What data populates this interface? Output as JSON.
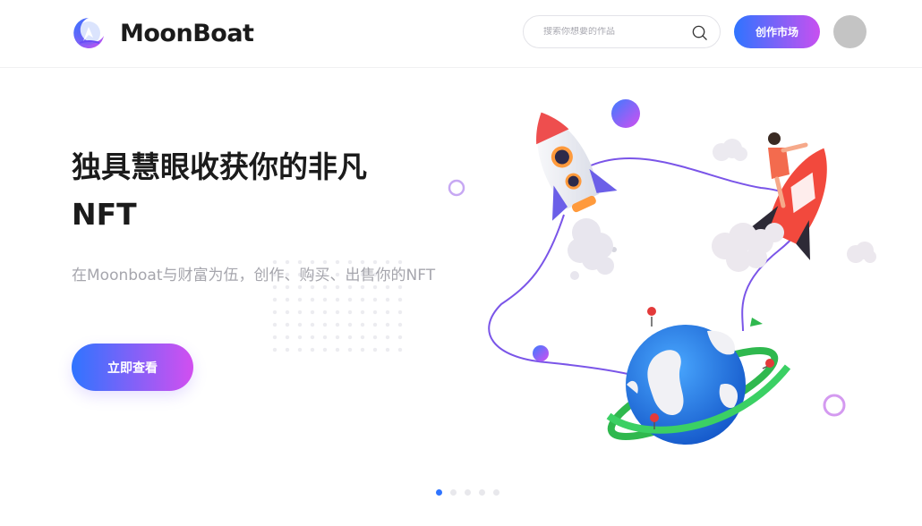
{
  "brand": {
    "name": "MoonBoat",
    "accent_start": "#2f74ff",
    "accent_end": "#c850f0"
  },
  "header": {
    "search": {
      "placeholder": "搜索你想要的作品",
      "value": "",
      "icon": "search-icon"
    },
    "market_button_label": "创作市场",
    "avatar": "user-avatar"
  },
  "hero": {
    "title_line1": "独具慧眼收获你的非凡",
    "title_line2": "NFT",
    "subtitle": "在Moonboat与财富为伍，创作、购买、出售你的NFT",
    "cta_label": "立即查看",
    "illustration": "rocket-earth-illustration"
  },
  "carousel": {
    "slide_count": 5,
    "active_index": 0
  }
}
